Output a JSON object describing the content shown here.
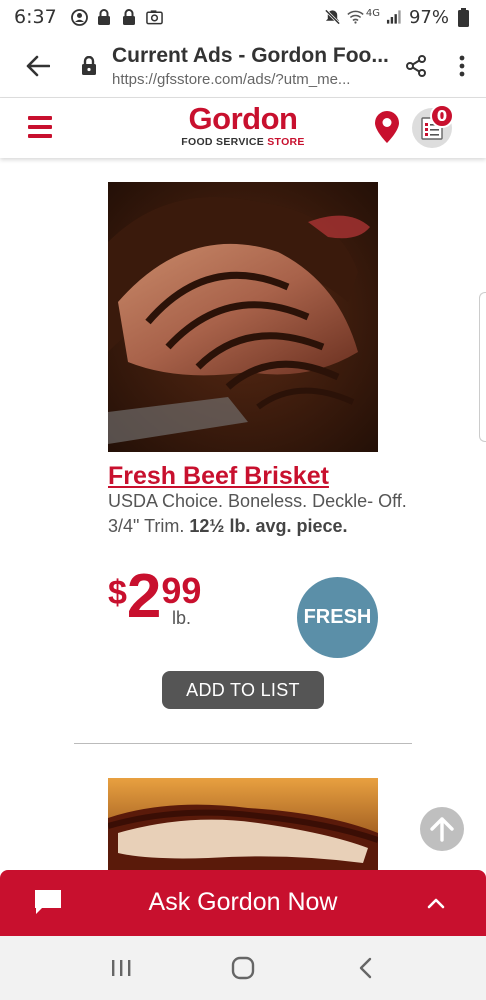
{
  "status": {
    "time": "6:37",
    "network": "4G",
    "battery": "97%"
  },
  "browser": {
    "page_title": "Current Ads - Gordon Foo...",
    "url": "https://gfsstore.com/ads/?utm_me..."
  },
  "header": {
    "logo_name": "Gordon",
    "logo_sub_a": "FOOD SERVICE ",
    "logo_sub_b": "STORE",
    "list_count": "0"
  },
  "product": {
    "title": "Fresh Beef Brisket",
    "desc_plain": "USDA Choice. Boneless. Deckle- Off. 3/4\" Trim. ",
    "desc_bold": "12½ lb. avg. piece.",
    "price_dollar": "$",
    "price_main": "2",
    "price_cents": "99",
    "price_unit": "lb.",
    "badge": "FRESH",
    "add_button": "ADD TO LIST"
  },
  "ask_bar": {
    "label": "Ask Gordon Now"
  },
  "colors": {
    "brand_red": "#c8102e",
    "fresh_badge": "#5b8fa8",
    "button_gray": "#555555"
  },
  "icons": {
    "back": "arrow-left-icon",
    "lock": "lock-icon",
    "share": "share-icon",
    "more": "more-vert-icon",
    "menu": "hamburger-icon",
    "location": "map-pin-icon",
    "list": "shopping-list-icon",
    "to_top": "arrow-up-icon",
    "chat": "chat-icon",
    "chevron": "chevron-up-icon"
  }
}
